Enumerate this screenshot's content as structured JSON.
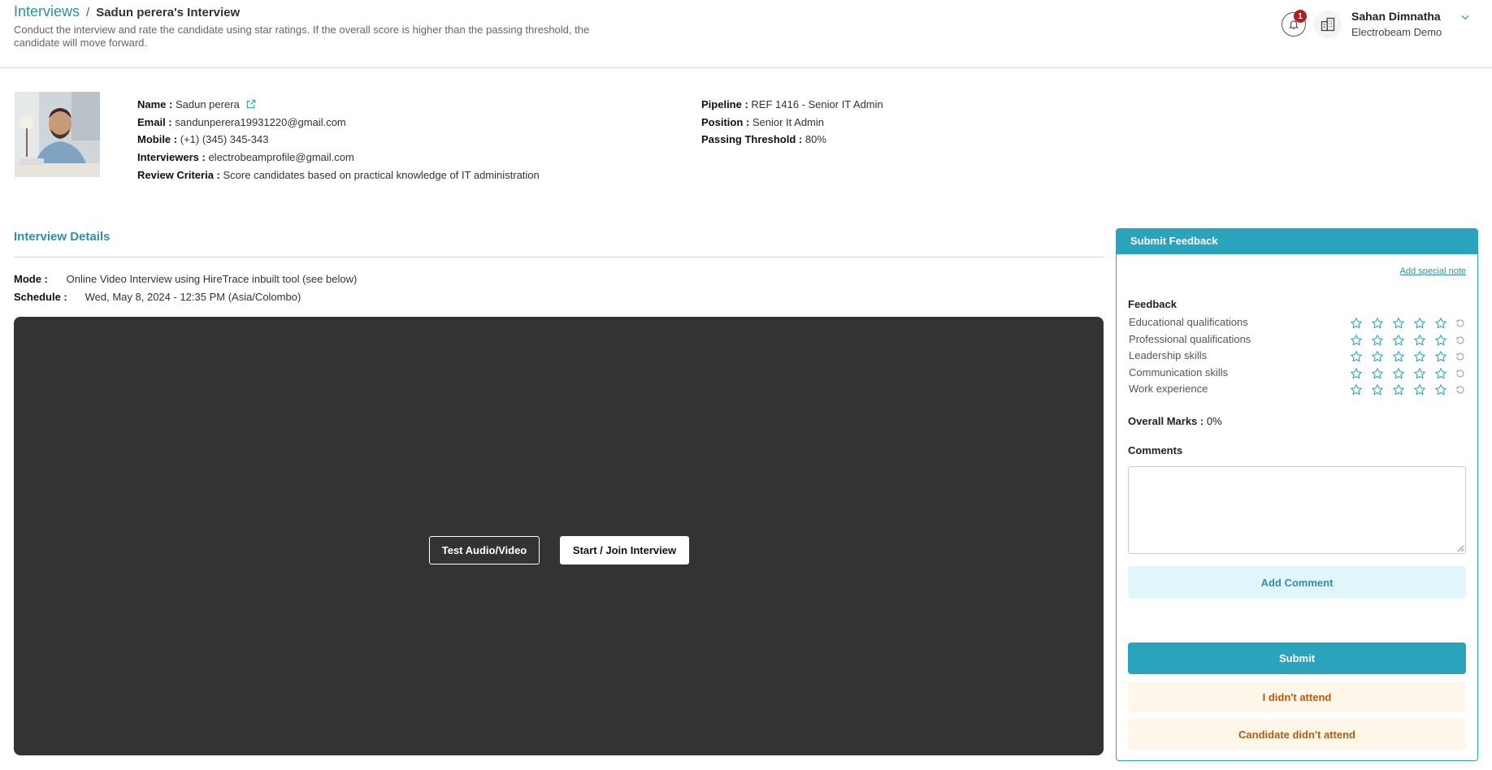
{
  "header": {
    "breadcrumb_root": "Interviews",
    "breadcrumb_sep": "/",
    "breadcrumb_current": "Sadun perera's Interview",
    "subtitle": "Conduct the interview and rate the candidate using star ratings. If the overall score is higher than the passing threshold, the candidate will move forward.",
    "notification_count": "1",
    "user_name": "Sahan Dimnatha",
    "user_org": "Electrobeam Demo"
  },
  "candidate": {
    "name_label": "Name :",
    "name": "Sadun perera",
    "email_label": "Email :",
    "email": "sandunperera19931220@gmail.com",
    "mobile_label": "Mobile :",
    "mobile": "(+1) (345) 345-343",
    "interviewers_label": "Interviewers :",
    "interviewers": "electrobeamprofile@gmail.com",
    "criteria_label": "Review Criteria :",
    "criteria": "Score candidates based on practical knowledge of IT administration",
    "pipeline_label": "Pipeline :",
    "pipeline": "REF 1416 - Senior IT Admin",
    "position_label": "Position :",
    "position": "Senior It Admin",
    "threshold_label": "Passing Threshold :",
    "threshold": "80%"
  },
  "details": {
    "title": "Interview Details",
    "mode_label": "Mode :",
    "mode": "Online Video Interview using HireTrace inbuilt tool (see below)",
    "schedule_label": "Schedule :",
    "schedule": "Wed, May 8, 2024 - 12:35 PM (Asia/Colombo)",
    "test_button": "Test Audio/Video",
    "join_button": "Start / Join Interview"
  },
  "feedback": {
    "title": "Submit Feedback",
    "add_note": "Add special note",
    "section_label": "Feedback",
    "criteria": [
      {
        "label": "Educational qualifications",
        "rating": 0
      },
      {
        "label": "Professional qualifications",
        "rating": 0
      },
      {
        "label": "Leadership skills",
        "rating": 0
      },
      {
        "label": "Communication skills",
        "rating": 0
      },
      {
        "label": "Work experience",
        "rating": 0
      }
    ],
    "overall_label": "Overall Marks :",
    "overall_value": "0%",
    "comments_label": "Comments",
    "comments_value": "",
    "add_comment_button": "Add Comment",
    "submit_button": "Submit",
    "i_didnt_attend_button": "I didn't attend",
    "candidate_didnt_attend_button": "Candidate didn't attend"
  },
  "colors": {
    "accent": "#2aa3bd",
    "link": "#2f8fa6",
    "video_bg": "#333333",
    "warn_text": "#b35a12",
    "badge": "#b91c1c"
  }
}
